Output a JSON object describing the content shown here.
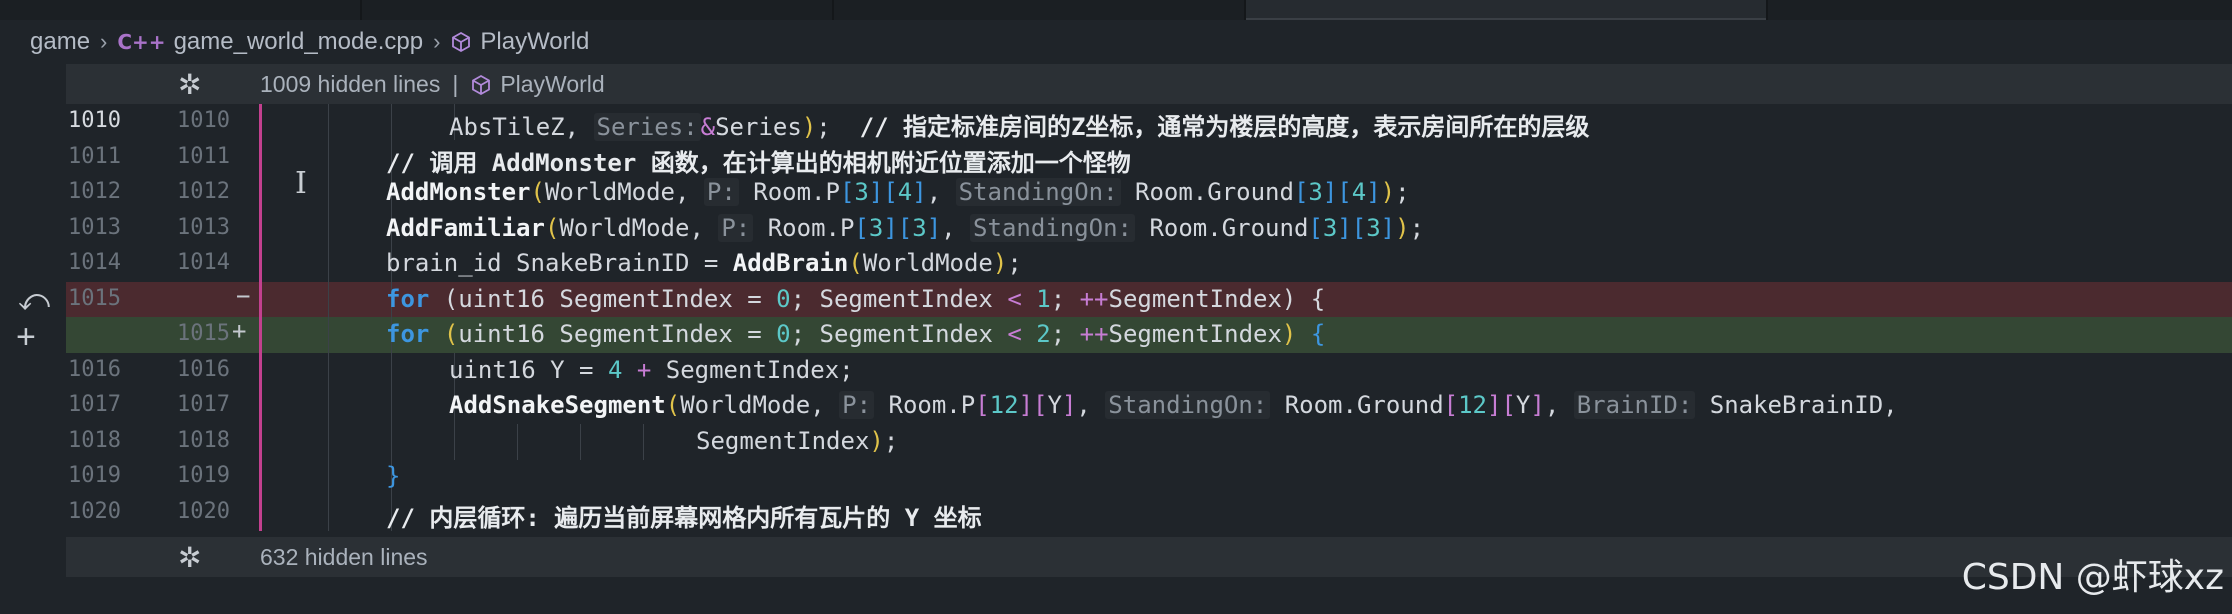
{
  "breadcrumb": {
    "folder": "game",
    "file_icon": "C++",
    "file": "game_world_mode.cpp",
    "symbol": "PlayWorld"
  },
  "fold_top": {
    "label": "1009 hidden lines",
    "symbol": "PlayWorld"
  },
  "fold_bottom": {
    "label": "632 hidden lines"
  },
  "lines": [
    {
      "ln_old": "1010",
      "ln_new": "1010",
      "indent": 1,
      "tokens": [
        [
          "id",
          "AbsTileZ, "
        ],
        [
          "hint",
          "Series:"
        ],
        [
          "op",
          "&"
        ],
        [
          "id",
          "Series"
        ],
        [
          "br1",
          ")"
        ],
        [
          "id",
          ";  "
        ],
        [
          "cm",
          "// 指定标准房间的Z坐标，通常为楼层的高度，表示房间所在的层级"
        ]
      ]
    },
    {
      "ln_old": "1011",
      "ln_new": "1011",
      "indent": 0,
      "tokens": [
        [
          "cm",
          "// 调用 AddMonster 函数，在计算出的相机附近位置添加一个怪物"
        ]
      ]
    },
    {
      "ln_old": "1012",
      "ln_new": "1012",
      "indent": 0,
      "tokens": [
        [
          "fn",
          "AddMonster"
        ],
        [
          "br1",
          "("
        ],
        [
          "id",
          "WorldMode, "
        ],
        [
          "hint",
          "P:"
        ],
        [
          "id",
          " Room.P"
        ],
        [
          "br2",
          "["
        ],
        [
          "num",
          "3"
        ],
        [
          "br2",
          "]["
        ],
        [
          "num",
          "4"
        ],
        [
          "br2",
          "]"
        ],
        [
          "id",
          ", "
        ],
        [
          "hint",
          "StandingOn:"
        ],
        [
          "id",
          " Room.Ground"
        ],
        [
          "br2",
          "["
        ],
        [
          "num",
          "3"
        ],
        [
          "br2",
          "]["
        ],
        [
          "num",
          "4"
        ],
        [
          "br2",
          "]"
        ],
        [
          "br1",
          ")"
        ],
        [
          "id",
          ";"
        ]
      ]
    },
    {
      "ln_old": "1013",
      "ln_new": "1013",
      "indent": 0,
      "tokens": [
        [
          "fn",
          "AddFamiliar"
        ],
        [
          "br1",
          "("
        ],
        [
          "id",
          "WorldMode, "
        ],
        [
          "hint",
          "P:"
        ],
        [
          "id",
          " Room.P"
        ],
        [
          "br2",
          "["
        ],
        [
          "num",
          "3"
        ],
        [
          "br2",
          "]["
        ],
        [
          "num",
          "3"
        ],
        [
          "br2",
          "]"
        ],
        [
          "id",
          ", "
        ],
        [
          "hint",
          "StandingOn:"
        ],
        [
          "id",
          " Room.Ground"
        ],
        [
          "br2",
          "["
        ],
        [
          "num",
          "3"
        ],
        [
          "br2",
          "]["
        ],
        [
          "num",
          "3"
        ],
        [
          "br2",
          "]"
        ],
        [
          "br1",
          ")"
        ],
        [
          "id",
          ";"
        ]
      ]
    },
    {
      "ln_old": "1014",
      "ln_new": "1014",
      "indent": 0,
      "tokens": [
        [
          "id",
          "brain_id SnakeBrainID = "
        ],
        [
          "fn",
          "AddBrain"
        ],
        [
          "br1",
          "("
        ],
        [
          "id",
          "WorldMode"
        ],
        [
          "br1",
          ")"
        ],
        [
          "id",
          ";"
        ]
      ]
    },
    {
      "ln_old": "1015",
      "ln_new": "",
      "indent": 0,
      "kind": "removed",
      "mark": "−",
      "tokens": [
        [
          "kw",
          "for"
        ],
        [
          "id",
          " (uint16 SegmentIndex = "
        ],
        [
          "num",
          "0"
        ],
        [
          "id",
          "; SegmentIndex "
        ],
        [
          "op",
          "<"
        ],
        [
          "id",
          " "
        ],
        [
          "num",
          "1"
        ],
        [
          "id",
          "; "
        ],
        [
          "op",
          "++"
        ],
        [
          "id",
          "SegmentIndex) {"
        ]
      ]
    },
    {
      "ln_old": "",
      "ln_new": "1015",
      "indent": 0,
      "kind": "added",
      "mark": "+",
      "tokens": [
        [
          "kw",
          "for"
        ],
        [
          "id",
          " "
        ],
        [
          "br1",
          "("
        ],
        [
          "id",
          "uint16 SegmentIndex = "
        ],
        [
          "num",
          "0"
        ],
        [
          "id",
          "; SegmentIndex "
        ],
        [
          "op",
          "<"
        ],
        [
          "id",
          " "
        ],
        [
          "num",
          "2"
        ],
        [
          "id",
          "; "
        ],
        [
          "op",
          "++"
        ],
        [
          "id",
          "SegmentIndex"
        ],
        [
          "br1",
          ")"
        ],
        [
          "id",
          " "
        ],
        [
          "br2",
          "{"
        ]
      ]
    },
    {
      "ln_old": "1016",
      "ln_new": "1016",
      "indent": 1,
      "tokens": [
        [
          "id",
          "uint16 Y = "
        ],
        [
          "num",
          "4"
        ],
        [
          "id",
          " "
        ],
        [
          "op",
          "+"
        ],
        [
          "id",
          " SegmentIndex;"
        ]
      ]
    },
    {
      "ln_old": "1017",
      "ln_new": "1017",
      "indent": 1,
      "tokens": [
        [
          "fn",
          "AddSnakeSegment"
        ],
        [
          "br1",
          "("
        ],
        [
          "id",
          "WorldMode, "
        ],
        [
          "hint",
          "P:"
        ],
        [
          "id",
          " Room.P"
        ],
        [
          "br3",
          "["
        ],
        [
          "num",
          "12"
        ],
        [
          "br3",
          "]["
        ],
        [
          "id",
          "Y"
        ],
        [
          "br3",
          "]"
        ],
        [
          "id",
          ", "
        ],
        [
          "hint",
          "StandingOn:"
        ],
        [
          "id",
          " Room.Ground"
        ],
        [
          "br3",
          "["
        ],
        [
          "num",
          "12"
        ],
        [
          "br3",
          "]["
        ],
        [
          "id",
          "Y"
        ],
        [
          "br3",
          "]"
        ],
        [
          "id",
          ", "
        ],
        [
          "hint",
          "BrainID:"
        ],
        [
          "id",
          " SnakeBrainID,"
        ]
      ]
    },
    {
      "ln_old": "1018",
      "ln_new": "1018",
      "indent": 2,
      "tokens": [
        [
          "id",
          "SegmentIndex"
        ],
        [
          "br1",
          ")"
        ],
        [
          "id",
          ";"
        ]
      ]
    },
    {
      "ln_old": "1019",
      "ln_new": "1019",
      "indent": 0,
      "tokens": [
        [
          "br2",
          "}"
        ]
      ]
    },
    {
      "ln_old": "1020",
      "ln_new": "1020",
      "indent": 0,
      "tokens": [
        [
          "cm",
          "// 内层循环: 遍历当前屏幕网格内所有瓦片的 Y 坐标"
        ]
      ]
    }
  ],
  "gutter_icons": [
    "revert-icon",
    "add-comment-icon"
  ],
  "watermark": "CSDN @虾球xz",
  "colors": {
    "removed_bg": "#4b2a2f",
    "added_bg": "#344734",
    "change_bar": "#c2408e"
  }
}
